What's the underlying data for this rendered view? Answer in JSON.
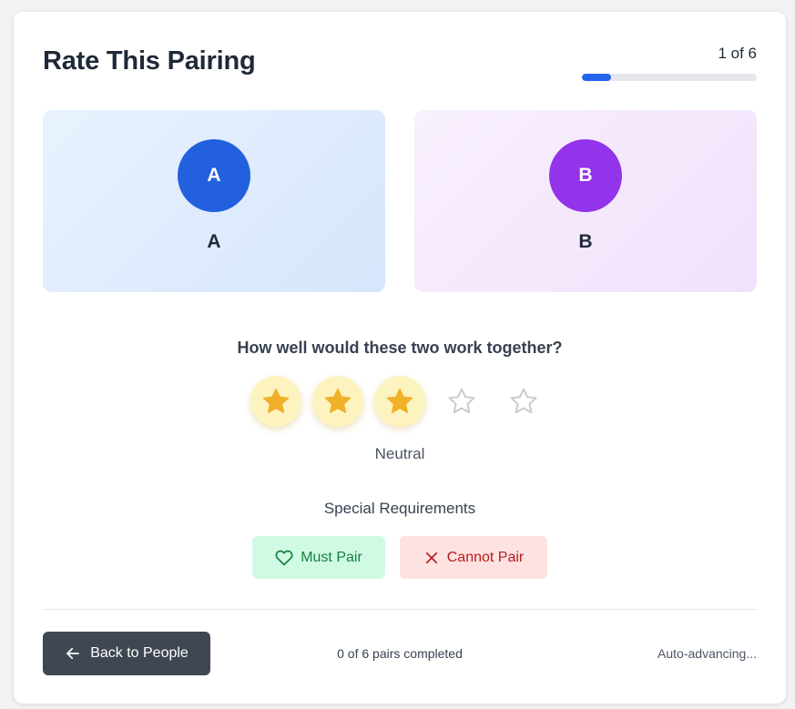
{
  "header": {
    "title": "Rate This Pairing",
    "progress_text": "1 of 6",
    "progress_fraction": 0.1667,
    "progress_color": "#2563eb"
  },
  "pair": {
    "person_a": {
      "initial": "A",
      "name": "A",
      "avatar_color": "#2260dd"
    },
    "person_b": {
      "initial": "B",
      "name": "B",
      "avatar_color": "#9333ea"
    }
  },
  "rating": {
    "question": "How well would these two work together?",
    "value": 3,
    "max": 5,
    "label": "Neutral",
    "star_color": "#f0b12a"
  },
  "special": {
    "title": "Special Requirements",
    "must_pair_label": "Must Pair",
    "must_pair_icon": "heart-icon",
    "cannot_pair_label": "Cannot Pair",
    "cannot_pair_icon": "x-icon"
  },
  "footer": {
    "back_label": "Back to People",
    "back_icon": "arrow-left-icon",
    "completed_text": "0 of 6 pairs completed",
    "auto_advance_text": "Auto-advancing..."
  }
}
